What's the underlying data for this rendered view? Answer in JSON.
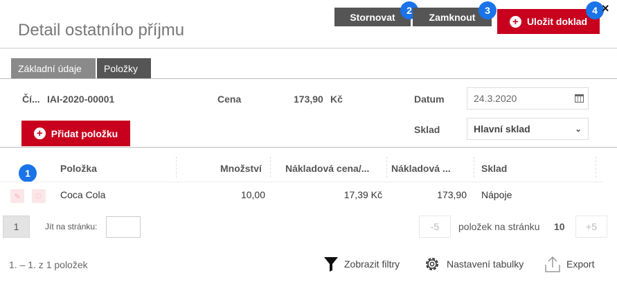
{
  "header": {
    "title": "Detail ostatního příjmu",
    "buttons": {
      "cancel": "Stornovat",
      "lock": "Zamknout",
      "save": "Uložit doklad"
    },
    "badges": {
      "cancel": "2",
      "lock": "3",
      "save": "4",
      "table": "1"
    },
    "close": "×"
  },
  "tabs": [
    {
      "label": "Základní údaje"
    },
    {
      "label": "Položky"
    }
  ],
  "form": {
    "number_label": "Čí...",
    "number_value": "IAI-2020-00001",
    "price_label": "Cena",
    "price_value": "173,90",
    "currency": "Kč",
    "date_label": "Datum",
    "date_value": "24.3.2020",
    "warehouse_label": "Sklad",
    "warehouse_value": "Hlavní sklad",
    "add_item": "Přidat položku"
  },
  "table": {
    "columns": [
      "Položka",
      "Množství",
      "Nákladová cena/...",
      "Nákladová ...",
      "Sklad"
    ],
    "rows": [
      {
        "item": "Coca Cola",
        "quantity": "10,00",
        "unit_cost": "17,39 Kč",
        "cost": "173,90",
        "warehouse": "Nápoje"
      }
    ]
  },
  "pagination": {
    "current_page": "1",
    "jump_label": "Jít na stránku:",
    "minus": "-5",
    "per_page_label": "položek na stránku",
    "per_page_value": "10",
    "plus": "+5",
    "range_text": "1. – 1. z 1 položek"
  },
  "actions": {
    "filters": "Zobrazit filtry",
    "settings": "Nastavení tabulky",
    "export": "Export"
  },
  "colors": {
    "primary_red": "#c8001e",
    "dark_button": "#555555",
    "badge_blue": "#1a73e8"
  }
}
